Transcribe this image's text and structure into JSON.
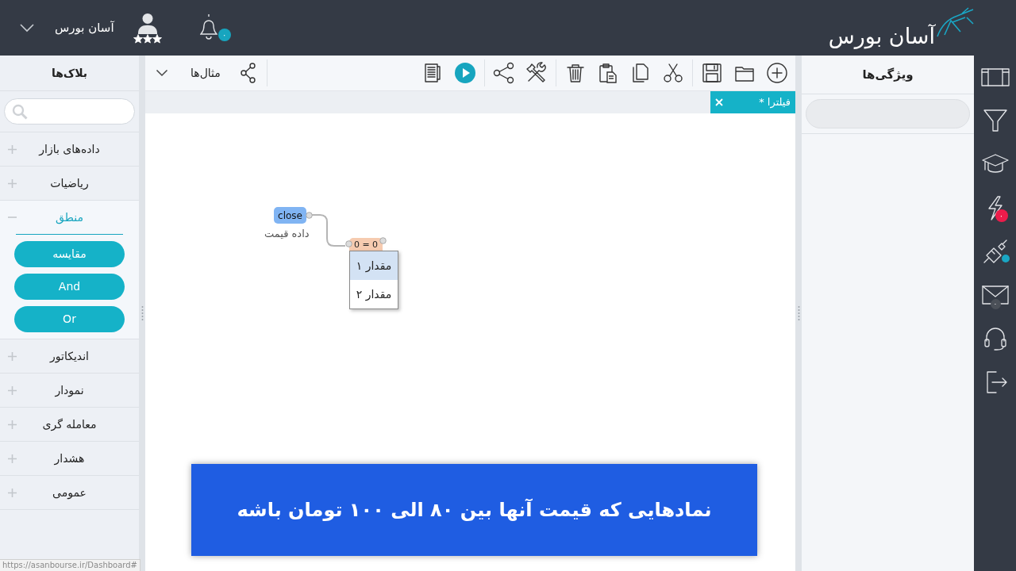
{
  "header": {
    "user": {
      "name": "آسان بورس",
      "stars": 3
    },
    "notifications": {
      "badge": "۰"
    },
    "logo": {
      "text": "آسان بورس"
    }
  },
  "blocks_panel": {
    "title": "بلاک‌ها",
    "categories": [
      {
        "label": "داده‌های بازار",
        "expanded": false
      },
      {
        "label": "ریاضیات",
        "expanded": false
      },
      {
        "label": "منطق",
        "expanded": true,
        "children": [
          {
            "label": "مقایسه"
          },
          {
            "label": "And"
          },
          {
            "label": "Or"
          }
        ]
      },
      {
        "label": "اندیکاتور",
        "expanded": false
      },
      {
        "label": "نمودار",
        "expanded": false
      },
      {
        "label": "معامله گری",
        "expanded": false
      },
      {
        "label": "هشدار",
        "expanded": false
      },
      {
        "label": "عمومی",
        "expanded": false
      }
    ]
  },
  "toolbar": {
    "examples_menu": {
      "label": "مثال‌ها"
    }
  },
  "tabs": [
    {
      "label": "فیلترا *",
      "selected": true
    }
  ],
  "canvas": {
    "nodes": [
      {
        "kind": "data",
        "text": "close",
        "caption": "داده قیمت"
      },
      {
        "kind": "operator",
        "text": "0 = 0"
      }
    ],
    "dropdown": {
      "items": [
        {
          "label": "مقدار ۱",
          "selected": true
        },
        {
          "label": "مقدار ۲",
          "selected": false
        }
      ]
    }
  },
  "properties_panel": {
    "title": "ویژگی‌ها"
  },
  "side_bar": {
    "badges": [
      {
        "text": "۰",
        "color": "#ec1c4b"
      },
      {
        "color": "#1aa6c4"
      },
      {
        "text": "۰",
        "color": "#4b5058"
      }
    ]
  },
  "caption": {
    "text": "نمادهایی که قیمت آنها بین ۸۰ الی ۱۰۰ تومان باشه"
  },
  "status_url": "https://asanbourse.ir/Dashboard#"
}
